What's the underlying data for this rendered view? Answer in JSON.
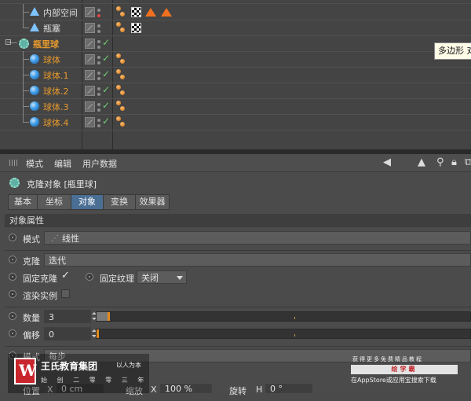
{
  "object_manager": {
    "rows": [
      {
        "label": "内部空间",
        "style": "white",
        "icon": "tri-icon"
      },
      {
        "label": "瓶塞",
        "style": "white",
        "icon": "tri-icon"
      },
      {
        "label": "瓶里球",
        "style": "orange",
        "icon": "cloner-icon"
      },
      {
        "label": "球体",
        "style": "orange",
        "icon": "sphere-icon"
      },
      {
        "label": "球体.1",
        "style": "orange",
        "icon": "sphere-icon"
      },
      {
        "label": "球体.2",
        "style": "orange",
        "icon": "sphere-icon"
      },
      {
        "label": "球体.3",
        "style": "orange",
        "icon": "sphere-icon"
      },
      {
        "label": "球体.4",
        "style": "orange",
        "icon": "sphere-icon"
      }
    ],
    "tooltip": "多边形 对象"
  },
  "attribute_manager": {
    "menu": [
      "模式",
      "编辑",
      "用户数据"
    ],
    "object_title": "克隆对象 [瓶里球]",
    "tabs": [
      "基本",
      "坐标",
      "对象",
      "变换",
      "效果器"
    ],
    "active_tab": "对象",
    "section": "对象属性",
    "params": {
      "mode": {
        "label": "模式",
        "value": "线性"
      },
      "clones": {
        "label": "克隆",
        "value": "迭代"
      },
      "fix_clone": {
        "label": "固定克隆",
        "checked": "✓"
      },
      "fix_texture": {
        "label": "固定纹理",
        "value": "关闭"
      },
      "render_instances": {
        "label": "渲染实例"
      },
      "count": {
        "label": "数量",
        "value": "3"
      },
      "offset": {
        "label": "偏移",
        "value": "0"
      },
      "mode2": {
        "label": "模式",
        "value": "每步"
      },
      "position": {
        "label": "位置",
        "axis": "X",
        "value": "0 cm"
      },
      "scale": {
        "label": "缩放",
        "axis": "X",
        "value": "100 %"
      },
      "rotation": {
        "label": "旋转",
        "axis": "H",
        "value": "0 °"
      }
    }
  },
  "watermark": {
    "logo_letter": "W",
    "brand": "王氏教育集团",
    "motto": "以人为本",
    "tagline": "始 创 二 零 零 三 年",
    "right_line1": "获得更多免费精品教程",
    "right_line2": "绘学霸",
    "right_line3": "在AppStore或应用宝搜索下载"
  },
  "colors": {
    "accent_orange": "#e89a2c",
    "active_tab": "#4b6f94",
    "check_green": "#6fd06f"
  }
}
